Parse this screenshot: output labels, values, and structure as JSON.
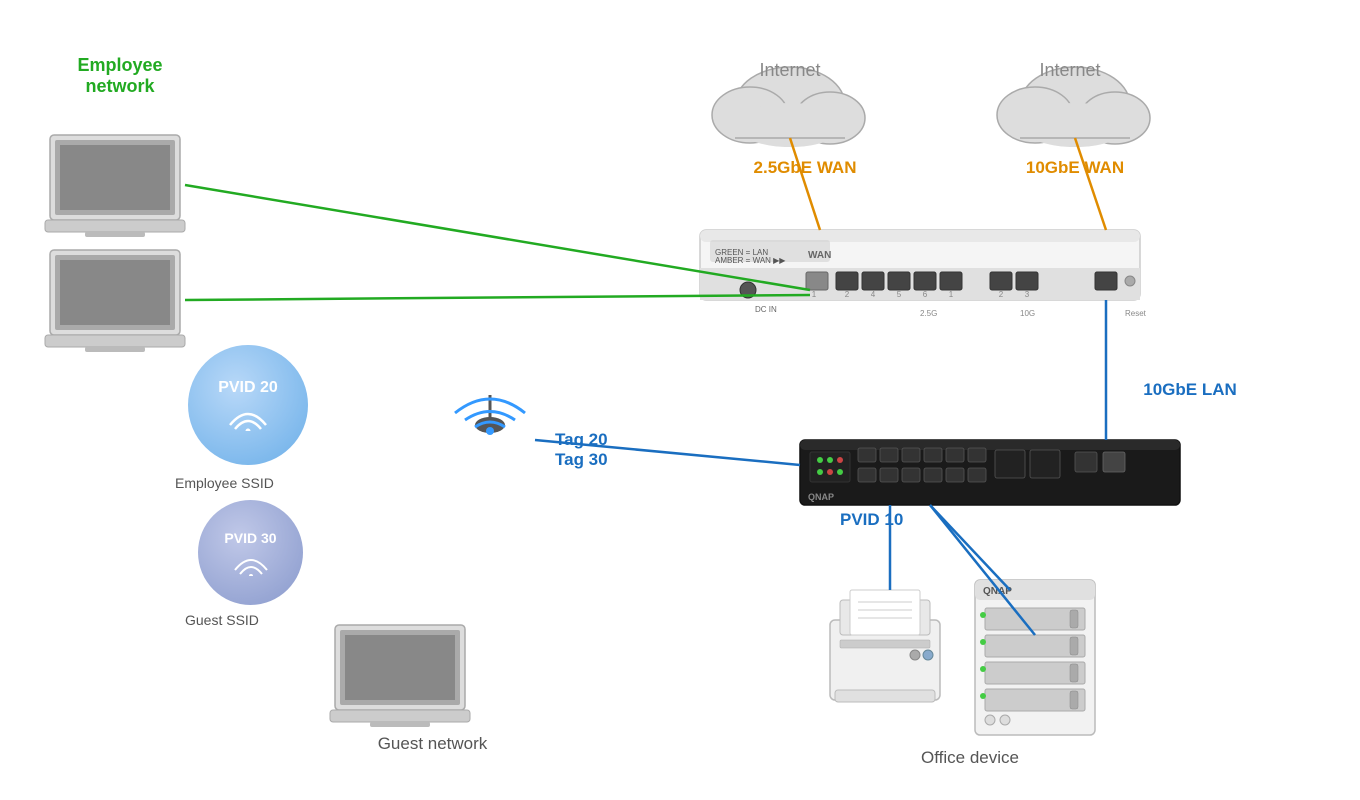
{
  "labels": {
    "employee_network": "Employee\nnetwork",
    "internet_1": "Internet",
    "internet_2": "Internet",
    "wan_1": "2.5GbE WAN",
    "wan_2": "10GbE WAN",
    "tag_20": "Tag 20",
    "tag_30": "Tag 30",
    "pvid_10": "PVID 10",
    "lan_10gbe": "10GbE LAN",
    "guest_network": "Guest network",
    "office_device": "Office device",
    "pvid_20_text": "PVID 20",
    "pvid_30_text": "PVID 30",
    "employee_ssid": "Employee SSID",
    "guest_ssid": "Guest SSID"
  },
  "colors": {
    "green": "#22aa22",
    "orange": "#e08c00",
    "blue": "#1a6ec0",
    "gray": "#888888",
    "light_blue_circle": "#6aaee8",
    "device_outline": "#444444"
  }
}
